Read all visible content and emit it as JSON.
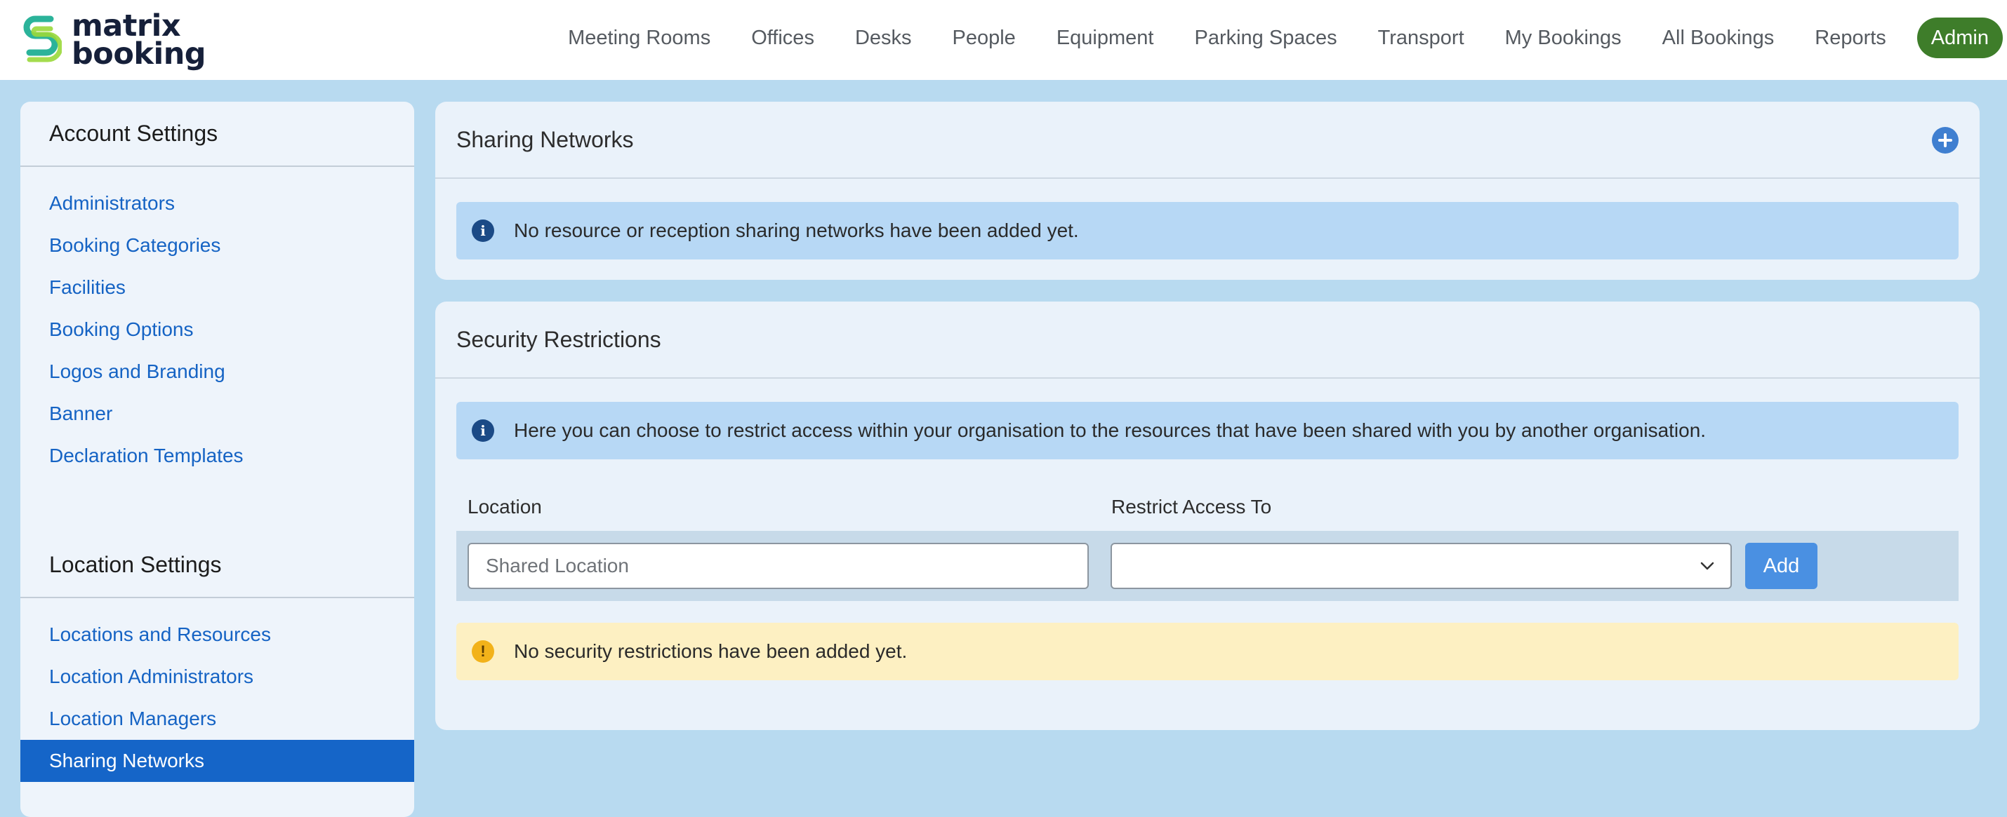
{
  "logo": {
    "line1": "matrix",
    "line2": "booking"
  },
  "nav": {
    "items": [
      "Meeting Rooms",
      "Offices",
      "Desks",
      "People",
      "Equipment",
      "Parking Spaces",
      "Transport",
      "My Bookings",
      "All Bookings",
      "Reports"
    ],
    "admin": "Admin"
  },
  "sidebar": {
    "account_heading": "Account Settings",
    "account_items": [
      "Administrators",
      "Booking Categories",
      "Facilities",
      "Booking Options",
      "Logos and Branding",
      "Banner",
      "Declaration Templates"
    ],
    "location_heading": "Location Settings",
    "location_items": [
      "Locations and Resources",
      "Location Administrators",
      "Location Managers",
      "Sharing Networks"
    ],
    "active_item": "Sharing Networks"
  },
  "sharing": {
    "title": "Sharing Networks",
    "info": "No resource or reception sharing networks have been added yet."
  },
  "security": {
    "title": "Security Restrictions",
    "info": "Here you can choose to restrict access within your organisation to the resources that have been shared with you by another organisation.",
    "location_label": "Location",
    "restrict_label": "Restrict Access To",
    "location_placeholder": "Shared Location",
    "restrict_value": "",
    "add_label": "Add",
    "warning": "No security restrictions have been added yet."
  },
  "colors": {
    "background": "#b8daf0",
    "admin_button": "#3e7d2a",
    "link": "#1563c4",
    "active_item": "#1565c8",
    "add_button": "#4a90e2",
    "info_alert": "#b7d8f5",
    "warn_alert": "#fdf0c2"
  },
  "icons": {
    "sharing_add": "plus-circle-icon",
    "info": "info-circle-icon",
    "warning": "exclamation-circle-icon",
    "select": "chevron-down-icon"
  }
}
